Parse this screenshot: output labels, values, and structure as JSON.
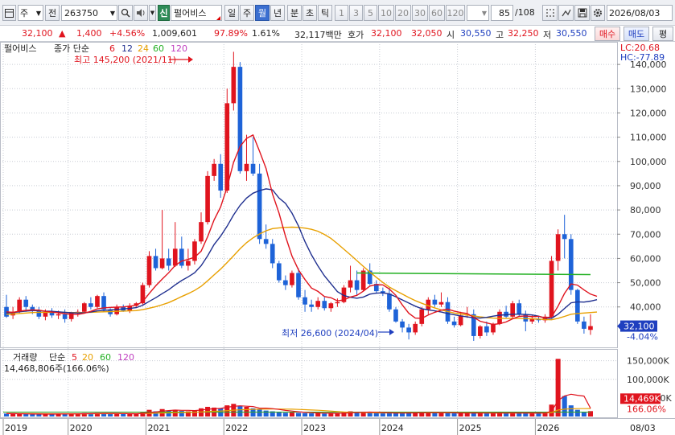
{
  "toolbar": {
    "market_code": "주",
    "period_prefix": "전",
    "stock_code": "263750",
    "badge_new": "신",
    "stock_name": "펄어비스",
    "period_tabs": [
      "일",
      "주",
      "월",
      "년",
      "분",
      "초",
      "틱"
    ],
    "selected_period": "월",
    "interval_buttons": [
      "1",
      "3",
      "5",
      "10",
      "20",
      "30",
      "60",
      "120"
    ],
    "page_counter": "85",
    "page_total": "/108",
    "date": "2026/08/03"
  },
  "quote": {
    "price": "32,100",
    "change_arrow": "▲",
    "change": "1,400",
    "change_pct": "+4.56%",
    "volume": "1,009,601",
    "volume_ratio": "97.89%",
    "turnover": "1.61%",
    "amount": "32,117백만",
    "bid_label": "호가",
    "bid_price": "32,100",
    "ask_price": "32,050",
    "open_label": "시",
    "open": "30,550",
    "high_label": "고",
    "high": "32,250",
    "low_label": "저",
    "low": "30,550",
    "buy_button": "매수",
    "sell_button": "매도",
    "eval_button": "평"
  },
  "chart_data": [
    {
      "type": "candlestick",
      "title": "펄어비스",
      "legend": {
        "label": "종가 단순",
        "periods": [
          "6",
          "12",
          "24",
          "60",
          "120"
        ],
        "colors": [
          "#e0141e",
          "#1f2f8f",
          "#e8a000",
          "#22b022",
          "#c040c0"
        ]
      },
      "max_label": "최고 145,200 (2021/11)",
      "min_label": "최저 26,600 (2024/04)",
      "corner_labels": {
        "lc": "LC:20.68",
        "hc": "HC:-77.89"
      },
      "ylim": [
        24000,
        148000
      ],
      "y_ticks": [
        40000,
        50000,
        60000,
        70000,
        80000,
        90000,
        100000,
        110000,
        120000,
        130000,
        140000
      ],
      "y_tick_labels": [
        "40,000",
        "50,000",
        "60,000",
        "70,000",
        "80,000",
        "90,000",
        "100,000",
        "110,000",
        "120,000",
        "130,000",
        "140,000"
      ],
      "current_price_label": "32,100",
      "current_pct_label": "-4.04%",
      "ma_line_60_value": 54000,
      "candles": [
        [
          40000,
          45000,
          35500,
          36000
        ],
        [
          36500,
          40000,
          35000,
          38000
        ],
        [
          38000,
          44000,
          37500,
          43000
        ],
        [
          43000,
          44500,
          38000,
          40000
        ],
        [
          40000,
          41000,
          37000,
          38500
        ],
        [
          38500,
          40000,
          35000,
          36000
        ],
        [
          36000,
          39000,
          34500,
          38000
        ],
        [
          38000,
          39500,
          35500,
          36500
        ],
        [
          36500,
          38500,
          35000,
          37000
        ],
        [
          37000,
          39000,
          33500,
          35000
        ],
        [
          35000,
          38000,
          34000,
          37500
        ],
        [
          37500,
          39000,
          36000,
          38000
        ],
        [
          38000,
          42000,
          37500,
          41500
        ],
        [
          41500,
          44000,
          39000,
          40000
        ],
        [
          40000,
          45000,
          39500,
          44500
        ],
        [
          44500,
          46000,
          38000,
          39000
        ],
        [
          39000,
          39500,
          36000,
          37000
        ],
        [
          37000,
          41000,
          36500,
          40000
        ],
        [
          40000,
          41000,
          38000,
          38500
        ],
        [
          38500,
          41500,
          37500,
          40500
        ],
        [
          40500,
          42000,
          40000,
          41500
        ],
        [
          41500,
          50000,
          41000,
          49000
        ],
        [
          49000,
          63000,
          48000,
          61000
        ],
        [
          61000,
          64000,
          55000,
          56000
        ],
        [
          56000,
          80000,
          55500,
          60000
        ],
        [
          60000,
          64000,
          55000,
          57000
        ],
        [
          57000,
          75000,
          56500,
          64000
        ],
        [
          64000,
          69000,
          56000,
          57000
        ],
        [
          57000,
          64000,
          55000,
          59000
        ],
        [
          59000,
          68000,
          57500,
          67000
        ],
        [
          67000,
          79000,
          66000,
          75000
        ],
        [
          75000,
          96000,
          74000,
          94000
        ],
        [
          94000,
          101000,
          92000,
          99000
        ],
        [
          99000,
          103000,
          85000,
          88000
        ],
        [
          88000,
          130000,
          87000,
          124000
        ],
        [
          124000,
          145200,
          121000,
          139000
        ],
        [
          139000,
          141000,
          95000,
          96000
        ],
        [
          96000,
          111000,
          92000,
          99000
        ],
        [
          99000,
          110000,
          94000,
          95000
        ],
        [
          95000,
          99000,
          66000,
          68000
        ],
        [
          68000,
          74000,
          64000,
          66000
        ],
        [
          66000,
          68000,
          56000,
          58000
        ],
        [
          58000,
          59000,
          50000,
          51000
        ],
        [
          51000,
          53000,
          47000,
          49000
        ],
        [
          49000,
          55000,
          48000,
          54000
        ],
        [
          54000,
          56000,
          43000,
          44000
        ],
        [
          44000,
          47000,
          38000,
          41000
        ],
        [
          41000,
          43000,
          38000,
          40000
        ],
        [
          40000,
          44000,
          39000,
          42500
        ],
        [
          42500,
          44000,
          38500,
          39500
        ],
        [
          39500,
          42000,
          38000,
          41500
        ],
        [
          41500,
          43500,
          40000,
          42000
        ],
        [
          42000,
          49000,
          41500,
          48000
        ],
        [
          48000,
          57000,
          46000,
          51000
        ],
        [
          51000,
          55000,
          45000,
          47000
        ],
        [
          47000,
          56000,
          46500,
          55000
        ],
        [
          55000,
          58000,
          49000,
          49500
        ],
        [
          49500,
          51000,
          45500,
          46500
        ],
        [
          46500,
          48000,
          44500,
          45500
        ],
        [
          45500,
          48000,
          38000,
          39000
        ],
        [
          39000,
          40000,
          33500,
          34000
        ],
        [
          34000,
          35000,
          29500,
          31500
        ],
        [
          31500,
          33000,
          26600,
          29500
        ],
        [
          29500,
          34000,
          28500,
          33000
        ],
        [
          33000,
          40000,
          32000,
          39000
        ],
        [
          39000,
          44000,
          37000,
          43000
        ],
        [
          43000,
          45000,
          40000,
          41000
        ],
        [
          41000,
          46000,
          40000,
          42000
        ],
        [
          42000,
          44000,
          33000,
          34000
        ],
        [
          34000,
          36000,
          31500,
          32500
        ],
        [
          32500,
          38000,
          32000,
          36500
        ],
        [
          36500,
          40000,
          35500,
          37000
        ],
        [
          37000,
          39000,
          26000,
          28000
        ],
        [
          28000,
          32500,
          27000,
          32000
        ],
        [
          32000,
          34000,
          28000,
          29500
        ],
        [
          29500,
          33500,
          28500,
          33000
        ],
        [
          33000,
          39000,
          32500,
          38000
        ],
        [
          38000,
          40500,
          35500,
          36000
        ],
        [
          36000,
          42500,
          35500,
          41500
        ],
        [
          41500,
          43000,
          36000,
          37000
        ],
        [
          37000,
          38500,
          30000,
          34000
        ],
        [
          34000,
          36500,
          33000,
          35000
        ],
        [
          35000,
          36000,
          33500,
          34500
        ],
        [
          34500,
          37000,
          33500,
          36000
        ],
        [
          36000,
          61000,
          35500,
          59000
        ],
        [
          59000,
          72000,
          55000,
          70000
        ],
        [
          70000,
          78000,
          60000,
          68000
        ],
        [
          68000,
          70000,
          45000,
          47000
        ],
        [
          47000,
          47500,
          33000,
          34000
        ],
        [
          34000,
          36000,
          29000,
          31000
        ],
        [
          30550,
          37000,
          28500,
          32100
        ]
      ],
      "ma6": [
        38000,
        37800,
        38300,
        38600,
        38800,
        38700,
        38200,
        37900,
        37600,
        37200,
        37000,
        36900,
        37400,
        38200,
        39200,
        39600,
        39800,
        39900,
        40000,
        40300,
        40700,
        42200,
        45600,
        48700,
        51500,
        54100,
        57100,
        58900,
        59600,
        60500,
        63000,
        69000,
        75900,
        81200,
        89400,
        99600,
        106200,
        109500,
        110900,
        104200,
        97100,
        86600,
        78700,
        69100,
        61000,
        55300,
        51300,
        47800,
        46400,
        44300,
        43800,
        42500,
        42900,
        44100,
        44800,
        46500,
        48600,
        49200,
        49100,
        47400,
        44800,
        40800,
        37400,
        35400,
        35300,
        36700,
        37800,
        38700,
        39100,
        38300,
        37700,
        37300,
        35700,
        34100,
        33400,
        32800,
        33100,
        33800,
        35100,
        36100,
        36300,
        36000,
        36100,
        35500,
        35900,
        40300,
        45600,
        49500,
        49000,
        47000,
        45300,
        44400
      ],
      "ma12": [
        37500,
        37700,
        38000,
        38300,
        38500,
        38500,
        38300,
        38200,
        38000,
        37800,
        37600,
        37500,
        37600,
        37900,
        38400,
        38600,
        38800,
        39000,
        39200,
        39400,
        39700,
        40700,
        42300,
        43800,
        45500,
        47100,
        49100,
        50900,
        52400,
        54100,
        57000,
        61100,
        65700,
        69200,
        73300,
        77900,
        81900,
        84900,
        86900,
        88000,
        88700,
        88300,
        84900,
        82700,
        78700,
        73400,
        66900,
        61500,
        56900,
        52800,
        49600,
        46300,
        44700,
        44000,
        43600,
        44100,
        45300,
        45700,
        45800,
        45400,
        44200,
        42900,
        41600,
        40300,
        39300,
        38800,
        38400,
        37900,
        37300,
        36800,
        36300,
        35900,
        35500,
        35400,
        35700,
        36200,
        36600,
        36800,
        37000,
        37000,
        36900,
        36700,
        36200,
        35400,
        35300,
        37000,
        39400,
        41700,
        42100,
        42000,
        42400,
        43000
      ],
      "ma24": [
        37000,
        37100,
        37300,
        37500,
        37700,
        37800,
        37800,
        37800,
        37800,
        37800,
        37700,
        37700,
        37700,
        37800,
        37900,
        38000,
        38100,
        38200,
        38300,
        38400,
        38500,
        38900,
        39500,
        40100,
        40900,
        41800,
        43000,
        44300,
        45500,
        46800,
        48500,
        50800,
        53200,
        55600,
        58300,
        61100,
        64000,
        66500,
        68500,
        70100,
        71400,
        72300,
        72600,
        72800,
        72900,
        72800,
        72500,
        72000,
        71200,
        69900,
        68300,
        66100,
        63800,
        61500,
        59100,
        56700,
        54400,
        52200,
        50100,
        48200,
        46700,
        45300,
        43900,
        42600,
        41500,
        40500,
        39600,
        38800,
        38100,
        37500,
        37100,
        36700,
        36300,
        35900,
        35600,
        35400,
        35300,
        35300,
        35300,
        35300,
        35200,
        35100,
        35000,
        34800,
        34700,
        35300,
        36100,
        37000,
        37300,
        37500,
        37700,
        37900
      ],
      "ma60_flat_from": 54,
      "ma60_flat_to": 90
    },
    {
      "type": "bar",
      "title": "거래량",
      "legend": {
        "label": "단순",
        "periods": [
          "5",
          "20",
          "60",
          "120"
        ],
        "colors": [
          "#e0141e",
          "#e8a000",
          "#22b022",
          "#c040c0"
        ]
      },
      "info_label": "14,468,806주(166.06%)",
      "ylim": [
        0,
        160000
      ],
      "y_ticks": [
        100000,
        150000
      ],
      "y_tick_labels": [
        "100,000K",
        "150,000K"
      ],
      "current_volume_label": "14,469K",
      "current_pct_label": "166.06%",
      "partial_tick_label": "50,000K",
      "values": [
        8000,
        9000,
        7500,
        6500,
        6000,
        7000,
        6500,
        7000,
        6800,
        7200,
        6900,
        7500,
        9000,
        8000,
        9500,
        8500,
        7000,
        7500,
        7000,
        7800,
        8000,
        12000,
        18000,
        14000,
        20000,
        16000,
        18000,
        15000,
        14000,
        17000,
        22000,
        26000,
        24000,
        22000,
        30000,
        34000,
        28000,
        26000,
        22000,
        20000,
        16000,
        14000,
        12000,
        10000,
        11000,
        9500,
        9000,
        8500,
        9000,
        8000,
        8500,
        8800,
        11000,
        14000,
        10500,
        12000,
        10000,
        9000,
        8500,
        9500,
        10000,
        9000,
        11000,
        9000,
        10500,
        12000,
        9500,
        9000,
        10000,
        8500,
        9000,
        8800,
        10500,
        9000,
        8500,
        8800,
        10000,
        9500,
        11000,
        9500,
        9000,
        8500,
        8800,
        9000,
        32000,
        155000,
        55000,
        30000,
        18000,
        12000,
        14469
      ],
      "ma5": [
        7800,
        7700,
        7400,
        7200,
        6800,
        6600,
        6500,
        6500,
        6700,
        6900,
        7000,
        7100,
        7500,
        7800,
        8200,
        8500,
        8500,
        8500,
        7900,
        7500,
        7400,
        8400,
        10400,
        12000,
        14200,
        16000,
        17200,
        16600,
        16600,
        16000,
        17200,
        19600,
        20800,
        21800,
        24800,
        27200,
        28800,
        27600,
        26800,
        22400,
        22400,
        21200,
        19000,
        16400,
        14600,
        12700,
        11100,
        10100,
        9600,
        9000,
        8900,
        8600,
        9100,
        10000,
        10500,
        11400,
        11900,
        11500,
        10500,
        10000,
        9500,
        9400,
        9600,
        9700,
        9900,
        10300,
        10500,
        10600,
        10300,
        10000,
        9500,
        9200,
        9500,
        9200,
        9300,
        9300,
        9600,
        9400,
        9700,
        9600,
        9700,
        9600,
        9600,
        9300,
        14000,
        42900,
        55400,
        60000,
        57000,
        55000,
        22000
      ],
      "ma20": [
        8000,
        8000,
        7900,
        7800,
        7700,
        7600,
        7500,
        7400,
        7300,
        7300,
        7300,
        7300,
        7300,
        7400,
        7500,
        7600,
        7600,
        7700,
        7700,
        7700,
        7800,
        8000,
        8500,
        8800,
        9400,
        9800,
        10300,
        10700,
        11000,
        11500,
        12300,
        13200,
        14000,
        14700,
        15800,
        17000,
        17900,
        18600,
        19100,
        19600,
        20000,
        20200,
        20200,
        20000,
        19600,
        19000,
        18300,
        17600,
        16800,
        15800,
        14600,
        13400,
        12200,
        11300,
        10800,
        10400,
        10100,
        9900,
        9800,
        9800,
        9800,
        9800,
        9900,
        9900,
        10000,
        10000,
        10000,
        10000,
        10000,
        10000,
        9900,
        9800,
        9800,
        9700,
        9700,
        9600,
        9600,
        9600,
        9600,
        9600,
        9600,
        9500,
        9500,
        9500,
        10600,
        17600,
        19700,
        20700,
        21100,
        21200,
        21500
      ],
      "ma60_value": 12000,
      "ma120_value": 11500
    }
  ],
  "x_axis": {
    "years": [
      "2019",
      "2020",
      "2021",
      "2022",
      "2023",
      "2024",
      "2025",
      "2026"
    ],
    "year_start_index": [
      0,
      10,
      22,
      34,
      46,
      58,
      70,
      82
    ],
    "end_label": "08/03"
  }
}
